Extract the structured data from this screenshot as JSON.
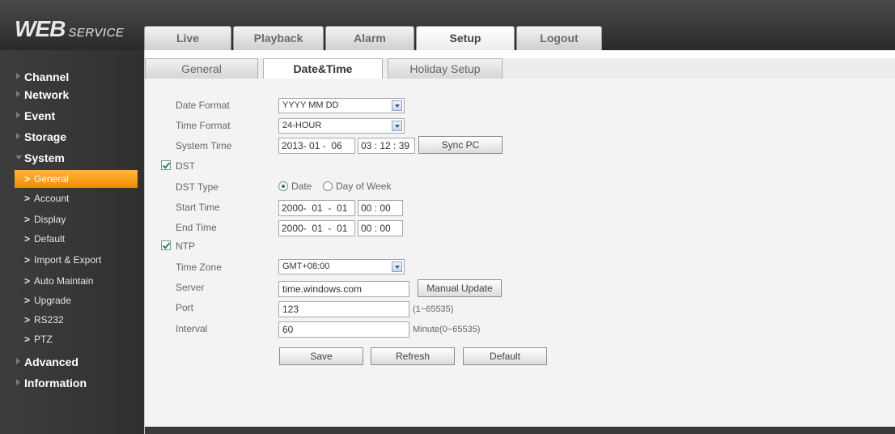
{
  "logo": {
    "bold": "WEB",
    "light": "SERVICE"
  },
  "main_tabs": [
    {
      "label": "Live"
    },
    {
      "label": "Playback"
    },
    {
      "label": "Alarm"
    },
    {
      "label": "Setup"
    },
    {
      "label": "Logout"
    }
  ],
  "sidebar": {
    "sections": [
      {
        "label": "Channel"
      },
      {
        "label": "Network"
      },
      {
        "label": "Event"
      },
      {
        "label": "Storage"
      },
      {
        "label": "System"
      },
      {
        "label": "Advanced"
      },
      {
        "label": "Information"
      }
    ],
    "system_items": [
      {
        "label": "General"
      },
      {
        "label": "Account"
      },
      {
        "label": "Display"
      },
      {
        "label": "Default"
      },
      {
        "label": "Import & Export"
      },
      {
        "label": "Auto Maintain"
      },
      {
        "label": "Upgrade"
      },
      {
        "label": "RS232"
      },
      {
        "label": "PTZ"
      }
    ],
    "arrow": ">"
  },
  "sub_tabs": [
    {
      "label": "General"
    },
    {
      "label": "Date&Time"
    },
    {
      "label": "Holiday Setup"
    }
  ],
  "form": {
    "date_format": {
      "label": "Date Format",
      "value": "YYYY MM DD"
    },
    "time_format": {
      "label": "Time Format",
      "value": "24-HOUR"
    },
    "system_time": {
      "label": "System Time",
      "date": "2013- 01 -  06",
      "time": "03 : 12 : 39",
      "sync_button": "Sync PC"
    },
    "dst": {
      "label": "DST"
    },
    "dst_type": {
      "label": "DST Type",
      "option_date": "Date",
      "option_week": "Day of Week"
    },
    "start_time": {
      "label": "Start Time",
      "date": "2000-  01  -  01",
      "time": "00 : 00"
    },
    "end_time": {
      "label": "End Time",
      "date": "2000-  01  -  01",
      "time": "00 : 00"
    },
    "ntp": {
      "label": "NTP"
    },
    "time_zone": {
      "label": "Time Zone",
      "value": "GMT+08:00"
    },
    "server": {
      "label": "Server",
      "value": "time.windows.com",
      "update_button": "Manual Update"
    },
    "port": {
      "label": "Port",
      "value": "123",
      "hint": "(1~65535)"
    },
    "interval": {
      "label": "Interval",
      "value": "60",
      "hint": "Minute(0~65535)"
    },
    "buttons": {
      "save": "Save",
      "refresh": "Refresh",
      "default": "Default"
    }
  },
  "colors": {
    "accent": "#f28a00",
    "frame": "#303030"
  }
}
